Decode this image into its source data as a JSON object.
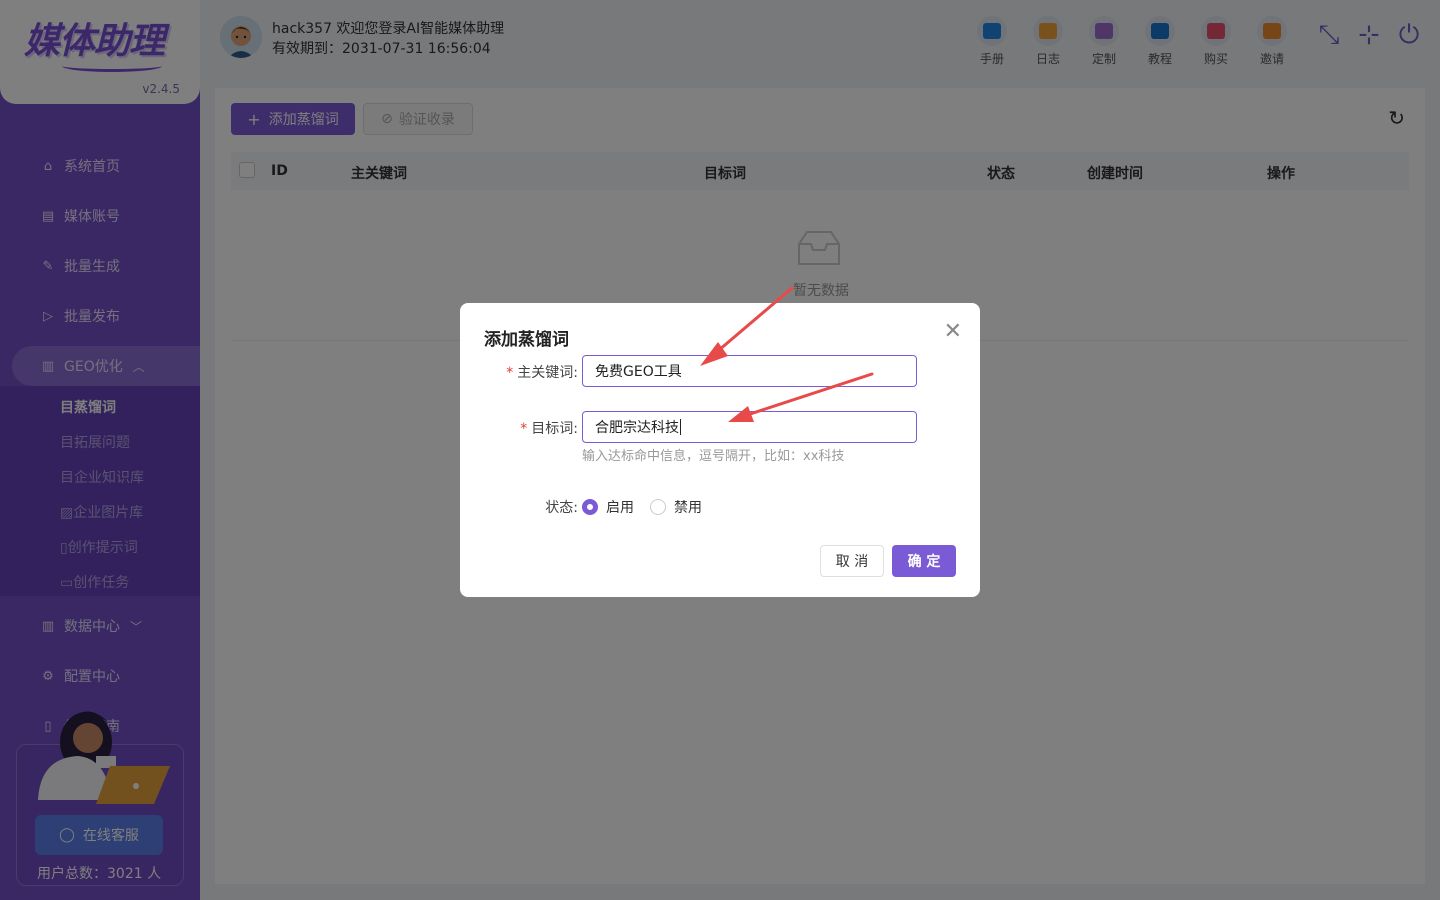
{
  "app": {
    "logo": "媒体助理",
    "version": "v2.4.5"
  },
  "header": {
    "welcome": "hack357 欢迎您登录AI智能媒体助理",
    "expire": "有效期到：2031-07-31 16:56:04",
    "tools": [
      {
        "label": "手册",
        "icon": "manual-icon",
        "color": "#1e88e5"
      },
      {
        "label": "日志",
        "icon": "log-icon",
        "color": "#f2a33a"
      },
      {
        "label": "定制",
        "icon": "custom-icon",
        "color": "#9c6cd1"
      },
      {
        "label": "教程",
        "icon": "tutorial-icon",
        "color": "#1976d2"
      },
      {
        "label": "购买",
        "icon": "purchase-icon",
        "color": "#e94f6b"
      },
      {
        "label": "邀请",
        "icon": "invite-icon",
        "color": "#ef8d2e"
      }
    ]
  },
  "sidebar": {
    "items": [
      {
        "label": "系统首页",
        "icon": "home-icon"
      },
      {
        "label": "媒体账号",
        "icon": "account-icon"
      },
      {
        "label": "批量生成",
        "icon": "edit-icon"
      },
      {
        "label": "批量发布",
        "icon": "send-icon"
      },
      {
        "label": "GEO优化",
        "icon": "doc-icon"
      },
      {
        "label": "数据中心",
        "icon": "doc-icon"
      },
      {
        "label": "配置中心",
        "icon": "gear-icon"
      },
      {
        "label": "使用指南",
        "icon": "book-icon"
      }
    ],
    "subitems": [
      "蒸馏词",
      "拓展问题",
      "企业知识库",
      "企业图片库",
      "创作提示词",
      "创作任务"
    ],
    "cs_button": "在线客服",
    "user_total": "用户总数：3021 人"
  },
  "toolbar": {
    "add_label": "添加蒸馏词",
    "verify_label": "验证收录"
  },
  "table": {
    "columns": [
      "ID",
      "主关键词",
      "目标词",
      "状态",
      "创建时间",
      "操作"
    ],
    "empty_text": "暂无数据"
  },
  "dialog": {
    "title": "添加蒸馏词",
    "main_keyword_label": "主关键词:",
    "main_keyword_value": "免费GEO工具",
    "target_label": "目标词:",
    "target_value": "合肥宗达科技",
    "target_hint": "输入达标命中信息，逗号隔开，比如：xx科技",
    "status_label": "状态:",
    "status_options": [
      "启用",
      "禁用"
    ],
    "status_selected": "启用",
    "cancel_label": "取 消",
    "ok_label": "确 定"
  },
  "colors": {
    "brand": "#7b5ad6",
    "sidebar": "#7551c9",
    "annotation_arrow": "#e84a4a"
  }
}
